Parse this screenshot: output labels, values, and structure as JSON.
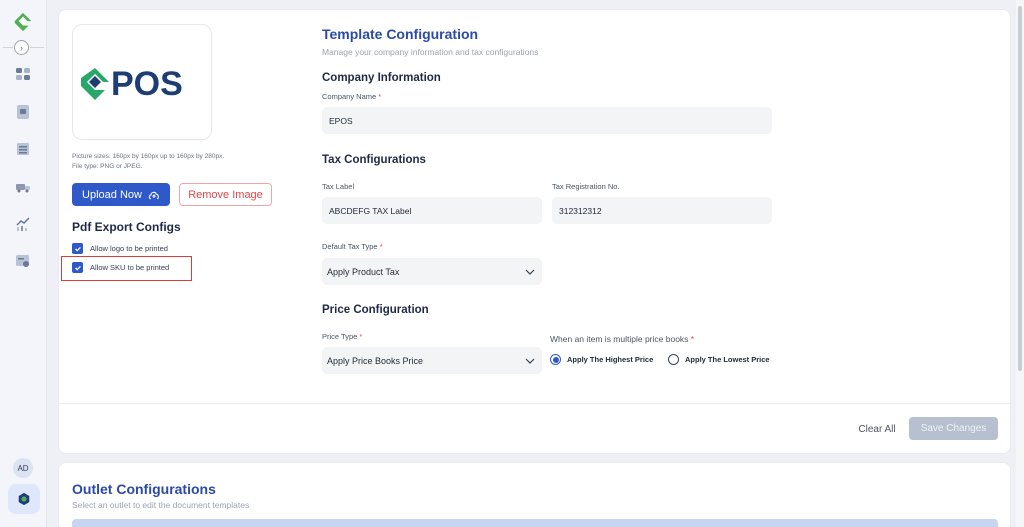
{
  "sidebar": {
    "avatar_initials": "AD",
    "brand_color": "#4caf50",
    "items": [
      {
        "icon": "dashboard-icon"
      },
      {
        "icon": "document-icon"
      },
      {
        "icon": "list-icon"
      },
      {
        "icon": "truck-icon"
      },
      {
        "icon": "chart-icon"
      },
      {
        "icon": "report-icon"
      }
    ]
  },
  "left_panel": {
    "logo_text": "POS",
    "pic_hint_line1": "Picture sizes: 160px by 160px up to 160px by 280px.",
    "pic_hint_line2": "File type: PNG or JPEG.",
    "upload_label": "Upload Now",
    "remove_label": "Remove Image",
    "pdf_title": "Pdf Export Configs",
    "checkboxes": [
      {
        "label": "Allow logo to be printed",
        "checked": true
      },
      {
        "label": "Allow SKU to be printed",
        "checked": true
      }
    ]
  },
  "template": {
    "title": "Template Configuration",
    "subtitle": "Manage your company information and tax configurations",
    "company_info_title": "Company Information",
    "company_name_label": "Company Name",
    "company_name_value": "EPOS",
    "tax_title": "Tax Configurations",
    "tax_label_label": "Tax Label",
    "tax_label_value": "ABCDEFG TAX Label",
    "tax_reg_label": "Tax Registration No.",
    "tax_reg_value": "312312312",
    "default_tax_label": "Default Tax Type",
    "default_tax_value": "Apply Product Tax",
    "price_title": "Price Configuration",
    "price_type_label": "Price Type",
    "price_type_value": "Apply Price Books Price",
    "multi_price_label": "When an item is multiple price books",
    "radio_highest": "Apply The Highest Price",
    "radio_lowest": "Apply The Lowest Price",
    "selected_radio": "highest",
    "clear_label": "Clear All",
    "save_label": "Save Changes",
    "required_mark": "*"
  },
  "outlet": {
    "title": "Outlet Configurations",
    "subtitle": "Select an outlet to edit the document templates"
  }
}
